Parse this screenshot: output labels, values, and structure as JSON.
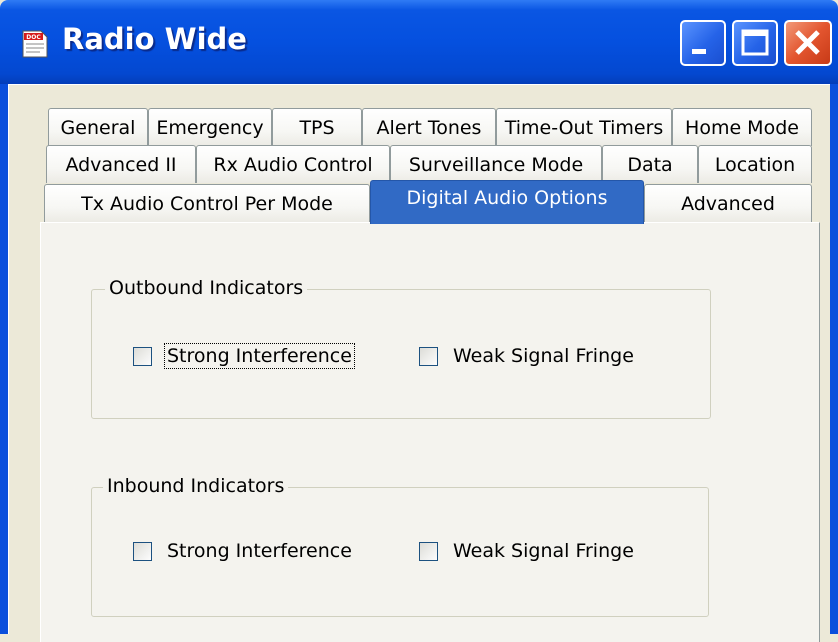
{
  "window": {
    "title": "Radio Wide",
    "app_icon": "doc-icon",
    "controls": [
      "minimize-icon",
      "maximize-icon",
      "close-icon"
    ]
  },
  "tabs": {
    "row1": [
      "General",
      "Emergency",
      "TPS",
      "Alert Tones",
      "Time-Out Timers",
      "Home Mode"
    ],
    "row2": [
      "Advanced II",
      "Rx Audio Control",
      "Surveillance Mode",
      "Data",
      "Location"
    ],
    "row3": [
      "Tx Audio Control Per Mode",
      "Digital Audio Options",
      "Advanced"
    ],
    "active": "Digital Audio Options"
  },
  "outbound": {
    "title": "Outbound Indicators",
    "options": [
      {
        "label": "Strong Interference",
        "checked": false,
        "focused": true
      },
      {
        "label": "Weak Signal Fringe",
        "checked": false
      }
    ]
  },
  "inbound": {
    "title": "Inbound Indicators",
    "options": [
      {
        "label": "Strong Interference",
        "checked": false
      },
      {
        "label": "Weak Signal Fringe",
        "checked": false
      }
    ]
  },
  "colors": {
    "titlebar": "#0550df",
    "active_tab": "#316ac5",
    "dialog_bg": "#ece9d8",
    "tab_panel_bg": "#f4f3ee",
    "close_button": "#e3552f"
  }
}
